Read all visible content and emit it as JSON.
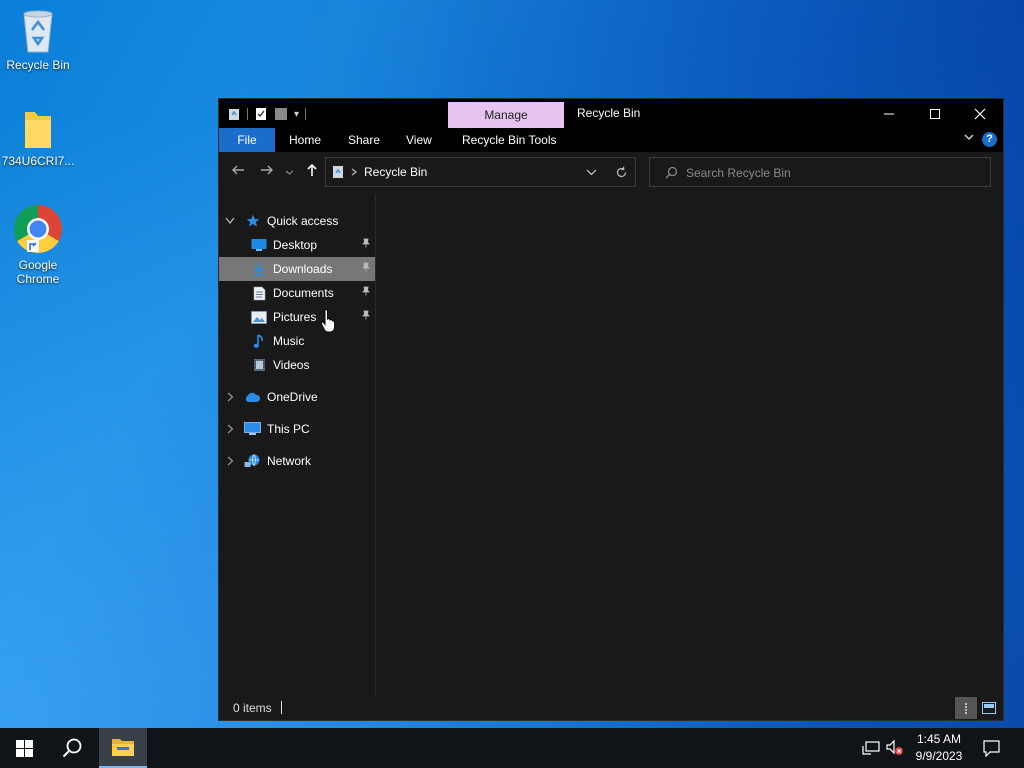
{
  "desktop": {
    "icons": [
      {
        "label": "Recycle Bin",
        "icon": "recycle-bin-icon"
      },
      {
        "label": "734U6CRI7...",
        "icon": "folder-icon"
      },
      {
        "label": "Google Chrome",
        "icon": "chrome-icon"
      }
    ]
  },
  "window": {
    "title": "Recycle Bin",
    "contextual_tab": "Manage",
    "ribbon_tabs": [
      "File",
      "Home",
      "Share",
      "View",
      "Recycle Bin Tools"
    ],
    "help_label": "?",
    "address": {
      "path": "Recycle Bin"
    },
    "search": {
      "placeholder": "Search Recycle Bin",
      "value": ""
    },
    "nav": {
      "quick_access": "Quick access",
      "items": [
        {
          "label": "Desktop",
          "icon": "desktop-icon",
          "pinned": true
        },
        {
          "label": "Downloads",
          "icon": "downloads-icon",
          "pinned": true,
          "selected": true
        },
        {
          "label": "Documents",
          "icon": "documents-icon",
          "pinned": true
        },
        {
          "label": "Pictures",
          "icon": "pictures-icon",
          "pinned": true
        },
        {
          "label": "Music",
          "icon": "music-icon",
          "pinned": false
        },
        {
          "label": "Videos",
          "icon": "videos-icon",
          "pinned": false
        }
      ],
      "roots": [
        {
          "label": "OneDrive",
          "icon": "onedrive-icon"
        },
        {
          "label": "This PC",
          "icon": "this-pc-icon"
        },
        {
          "label": "Network",
          "icon": "network-icon"
        }
      ]
    },
    "status": "0 items"
  },
  "taskbar": {
    "time": "1:45 AM",
    "date": "9/9/2023"
  },
  "colors": {
    "accent": "#1a6ec9",
    "manage_tab": "#e5c4ef",
    "window_bg": "#191919",
    "selection": "#777777",
    "taskbar": "#101418"
  }
}
